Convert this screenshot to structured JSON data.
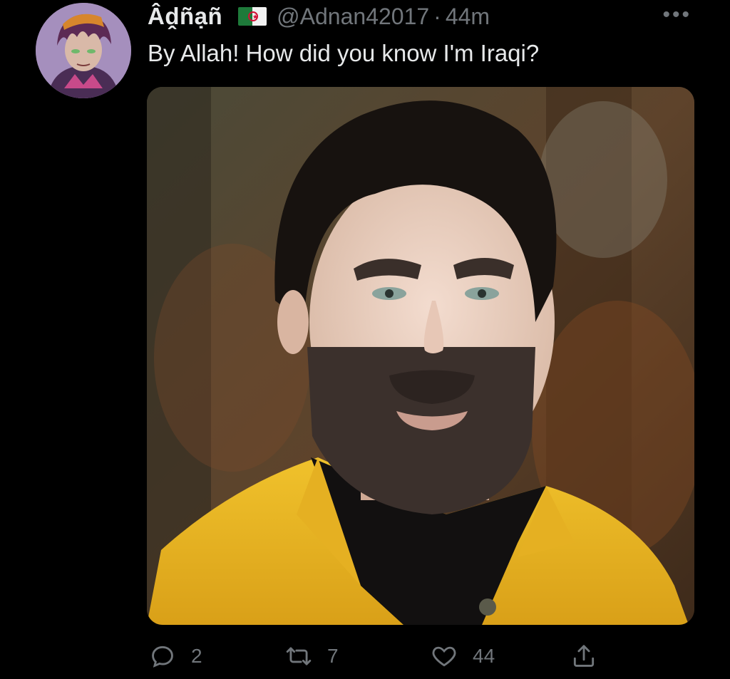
{
  "tweet": {
    "display_name": "Âḓñạñ",
    "flag_icon": "algeria-flag-icon",
    "handle": "@Adnan42017",
    "separator": "·",
    "time": "44m",
    "more_icon": "more-options-icon",
    "text": "By Allah! How did you know I'm Iraqi?",
    "media": {
      "description_icon": "photo-of-man-with-painted-beard"
    }
  },
  "actions": {
    "reply": {
      "icon": "reply-icon",
      "count": "2"
    },
    "retweet": {
      "icon": "retweet-icon",
      "count": "7"
    },
    "like": {
      "icon": "heart-icon",
      "count": "44"
    },
    "share": {
      "icon": "share-icon"
    }
  },
  "colors": {
    "background": "#000000",
    "text_primary": "#e7e9ea",
    "text_secondary": "#71767b"
  }
}
